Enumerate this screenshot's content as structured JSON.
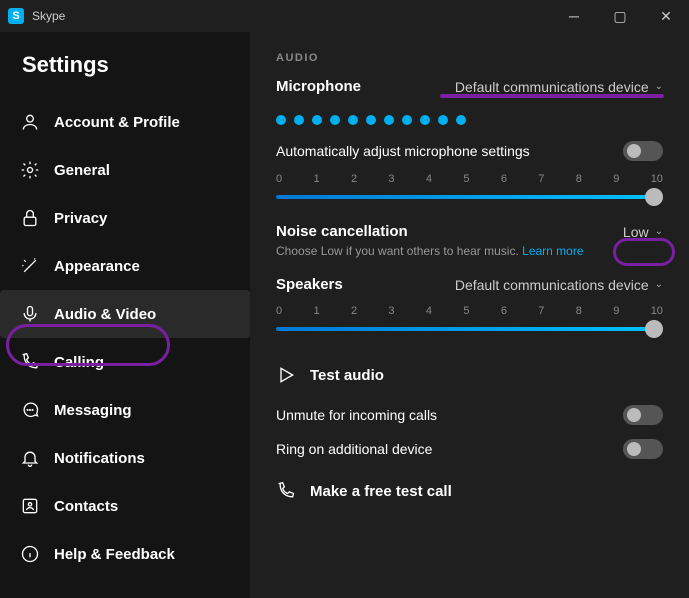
{
  "titlebar": {
    "app": "Skype"
  },
  "sidebar": {
    "heading": "Settings",
    "items": [
      {
        "label": "Account & Profile"
      },
      {
        "label": "General"
      },
      {
        "label": "Privacy"
      },
      {
        "label": "Appearance"
      },
      {
        "label": "Audio & Video"
      },
      {
        "label": "Calling"
      },
      {
        "label": "Messaging"
      },
      {
        "label": "Notifications"
      },
      {
        "label": "Contacts"
      },
      {
        "label": "Help & Feedback"
      }
    ]
  },
  "main": {
    "section": "AUDIO",
    "microphone": {
      "label": "Microphone",
      "device": "Default communications device"
    },
    "auto_adjust": {
      "label": "Automatically adjust microphone settings"
    },
    "ticks": [
      "0",
      "1",
      "2",
      "3",
      "4",
      "5",
      "6",
      "7",
      "8",
      "9",
      "10"
    ],
    "noise": {
      "label": "Noise cancellation",
      "value": "Low",
      "help": "Choose Low if you want others to hear music.",
      "learn": "Learn more"
    },
    "speakers": {
      "label": "Speakers",
      "device": "Default communications device"
    },
    "test_audio": "Test audio",
    "unmute": {
      "label": "Unmute for incoming calls"
    },
    "ring": {
      "label": "Ring on additional device"
    },
    "test_call": "Make a free test call"
  }
}
